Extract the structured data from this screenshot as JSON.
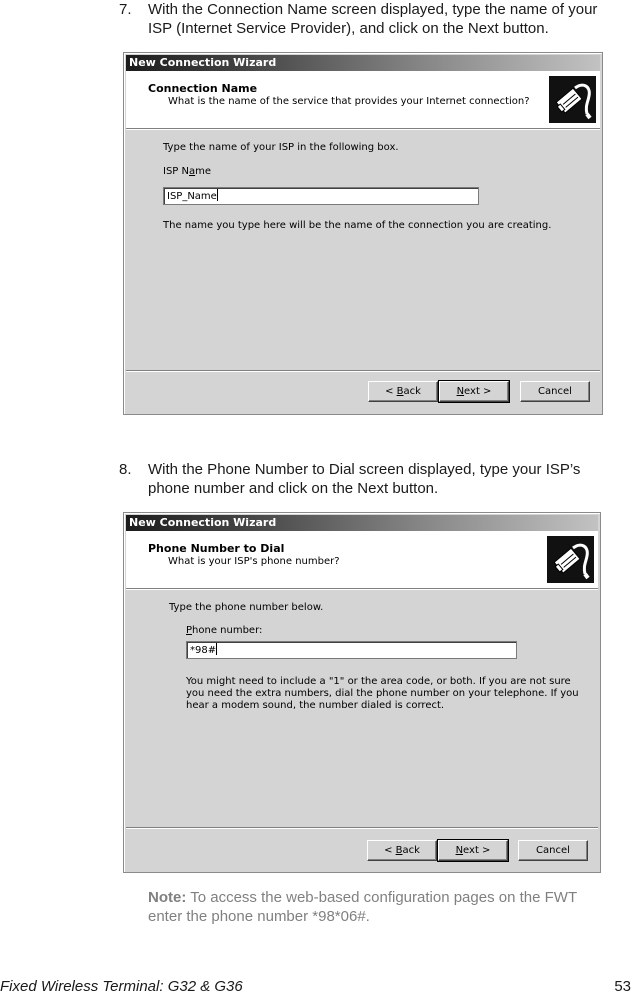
{
  "steps": [
    {
      "number": "7.",
      "line1": "With the Connection Name screen displayed, type the name of your",
      "line2": "ISP (Internet Service Provider), and click on the Next button."
    },
    {
      "number": "8.",
      "line1": "With the Phone Number to Dial screen displayed, type your ISP’s",
      "line2": "phone number and click on the Next button."
    }
  ],
  "dialog1": {
    "title": "New Connection Wizard",
    "header_title": "Connection Name",
    "header_subtitle": "What is the name of the service that provides your Internet connection?",
    "icon": "network-cable-icon",
    "instruction": "Type the name of your ISP in the following box.",
    "field_label_pre": "ISP N",
    "field_label_underlined": "a",
    "field_label_post": "me",
    "field_value": "ISP_Name",
    "hint": "The name you type here will be the name of the connection you are creating.",
    "buttons": {
      "back_pre": "< ",
      "back_underlined": "B",
      "back_post": "ack",
      "next_underlined": "N",
      "next_post": "ext >",
      "cancel": "Cancel"
    }
  },
  "dialog2": {
    "title": "New Connection Wizard",
    "header_title": "Phone Number to Dial",
    "header_subtitle": "What is your ISP's phone number?",
    "icon": "network-cable-icon",
    "instruction": "Type the phone number below.",
    "field_label_underlined": "P",
    "field_label_post": "hone number:",
    "field_value": "*98#",
    "hint_lines": [
      "You might need to include a \"1\" or the area code, or both. If you are not sure",
      "you need the extra numbers, dial the phone number on your telephone. If you",
      "hear a modem sound, the number dialed is correct."
    ],
    "buttons": {
      "back_pre": "< ",
      "back_underlined": "B",
      "back_post": "ack",
      "next_underlined": "N",
      "next_post": "ext >",
      "cancel": "Cancel"
    }
  },
  "note": {
    "label": "Note:",
    "line1": " To access the web-based configuration pages on the FWT",
    "line2": "enter the phone number *98*06#."
  },
  "footer": {
    "title": "Fixed Wireless Terminal: G32 & G36",
    "page_number": "53"
  }
}
